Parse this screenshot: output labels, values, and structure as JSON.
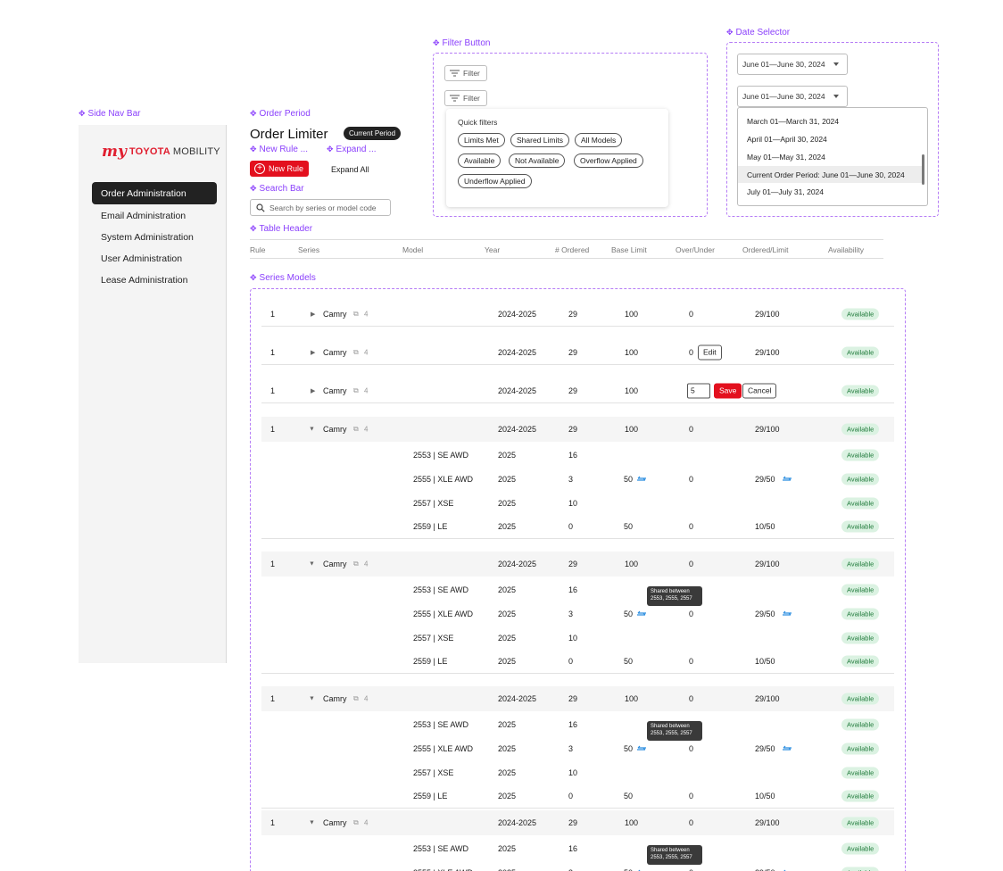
{
  "annotations": {
    "side_nav": "Side Nav Bar",
    "order_period": "Order Period",
    "new_rule": "New Rule ...",
    "expand": "Expand ...",
    "search_bar": "Search Bar",
    "table_header": "Table Header",
    "series_models": "Series Models",
    "filter_button": "Filter Button",
    "date_selector": "Date Selector"
  },
  "brand": {
    "my": "my",
    "toyota": "TOYOTA",
    "mobility": "MOBILITY",
    "red": "#e01e2f"
  },
  "sidebar": {
    "items": [
      {
        "label": "Order Administration",
        "active": true
      },
      {
        "label": "Email Administration"
      },
      {
        "label": "System Administration"
      },
      {
        "label": "User Administration"
      },
      {
        "label": "Lease Administration"
      }
    ]
  },
  "header": {
    "title": "Order Limiter",
    "badge": "Current Period",
    "new_rule_label": "New Rule",
    "expand_all_label": "Expand All"
  },
  "search": {
    "placeholder": "Search by series or model code"
  },
  "table": {
    "columns": [
      "Rule",
      "Series",
      "Model",
      "Year",
      "# Ordered",
      "Base Limit",
      "Over/Under",
      "Ordered/Limit",
      "Availability"
    ]
  },
  "filter": {
    "button_label": "Filter",
    "quick_filters_title": "Quick filters",
    "chips": [
      "Limits Met",
      "Shared Limits",
      "All Models",
      "Available",
      "Not Available",
      "Overflow Applied",
      "Underflow Applied"
    ]
  },
  "date_selector": {
    "value": "June 01—June 30, 2024",
    "options": [
      "March 01—March 31, 2024",
      "April 01—April 30, 2024",
      "May 01—May 31, 2024",
      "Current Order Period: June 01—June 30, 2024",
      "July 01—July 31, 2024"
    ],
    "selected_index": 3
  },
  "rows": {
    "series": [
      {
        "rule": "1",
        "series": "Camry",
        "count": "4",
        "year": "2024-2025",
        "ordered": "29",
        "base": "100",
        "over": "0",
        "ratio": "29/100",
        "availability": "Available"
      },
      {
        "rule": "1",
        "series": "Camry",
        "count": "4",
        "year": "2024-2025",
        "ordered": "29",
        "base": "100",
        "over": "0",
        "ratio": "29/100",
        "availability": "Available",
        "edit_label": "Edit"
      },
      {
        "rule": "1",
        "series": "Camry",
        "count": "4",
        "year": "2024-2025",
        "ordered": "29",
        "base": "100",
        "edit_value": "5",
        "save_label": "Save",
        "cancel_label": "Cancel",
        "availability": "Available"
      },
      {
        "rule": "1",
        "series": "Camry",
        "count": "4",
        "year": "2024-2025",
        "ordered": "29",
        "base": "100",
        "over": "0",
        "ratio": "29/100",
        "availability": "Available"
      },
      {
        "rule": "1",
        "series": "Camry",
        "count": "4",
        "year": "2024-2025",
        "ordered": "29",
        "base": "100",
        "over": "0",
        "ratio": "29/100",
        "availability": "Available"
      },
      {
        "rule": "1",
        "series": "Camry",
        "count": "4",
        "year": "2024-2025",
        "ordered": "29",
        "base": "100",
        "over": "0",
        "ratio": "29/100",
        "availability": "Available"
      },
      {
        "rule": "1",
        "series": "Camry",
        "count": "4",
        "year": "2024-2025",
        "ordered": "29",
        "base": "100",
        "over": "0",
        "ratio": "29/100",
        "availability": "Available"
      }
    ],
    "models": [
      {
        "model": "2553 | SE AWD",
        "year": "2025",
        "ordered": "16",
        "availability": "Available"
      },
      {
        "model": "2555 | XLE AWD",
        "year": "2025",
        "ordered": "3",
        "base": "50",
        "over": "0",
        "ratio": "29/50",
        "availability": "Available"
      },
      {
        "model": "2557 | XSE",
        "year": "2025",
        "ordered": "10",
        "availability": "Available"
      },
      {
        "model": "2559 | LE",
        "year": "2025",
        "ordered": "0",
        "base": "50",
        "over": "0",
        "ratio": "10/50",
        "availability": "Available"
      }
    ],
    "tooltip": {
      "line1": "Shared between",
      "line2": "2553, 2555, 2557"
    }
  },
  "colors": {
    "accent": "#e3101e",
    "available_bg": "#dbf2e2",
    "available_fg": "#1f7a3a",
    "annotation": "#8a3ffc"
  }
}
